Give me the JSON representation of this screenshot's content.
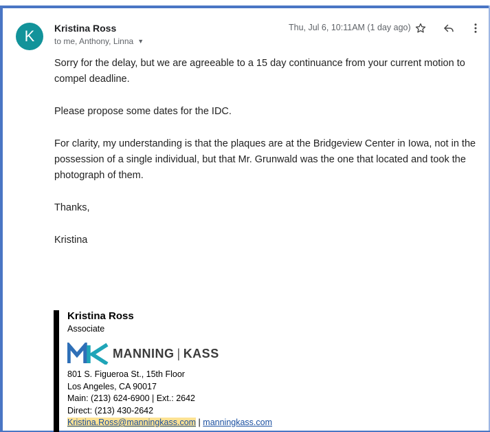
{
  "email": {
    "avatar_letter": "K",
    "sender_name": "Kristina Ross",
    "recipients": "to me, Anthony, Linna",
    "timestamp": "Thu, Jul 6, 10:11AM (1 day ago)",
    "icons": {
      "star": "star-icon",
      "reply": "reply-icon",
      "more": "more-vert-icon",
      "expand": "chevron-down-icon"
    },
    "body": [
      "Sorry for the delay, but we are agreeable to a 15 day continuance from your current motion to compel deadline.",
      "Please propose some dates for the IDC.",
      "For clarity, my understanding is that the plaques are at the Bridgeview Center in Iowa, not in the possession of a single individual, but that Mr. Grunwald was the one that located and took the photograph of them.",
      "Thanks,",
      "Kristina"
    ]
  },
  "signature": {
    "name": "Kristina Ross",
    "title": "Associate",
    "logo_left": "MANNING",
    "logo_sep": "|",
    "logo_right": "KASS",
    "address1": "801 S. Figueroa St., 15th Floor",
    "address2": "Los Angeles, CA 90017",
    "main_phone": "Main: (213) 624-6900 | Ext.: 2642",
    "direct_phone": "Direct: (213) 430-2642",
    "email": "Kristina.Ross@manningkass.com",
    "link_sep": "|",
    "website": "manningkass.com"
  },
  "colors": {
    "frame": "#4a76c4",
    "avatar": "#12939a",
    "logo_blue": "#2e6fb7",
    "logo_teal": "#1fa5b8",
    "link": "#1a4fa0",
    "highlight": "#fde293"
  }
}
